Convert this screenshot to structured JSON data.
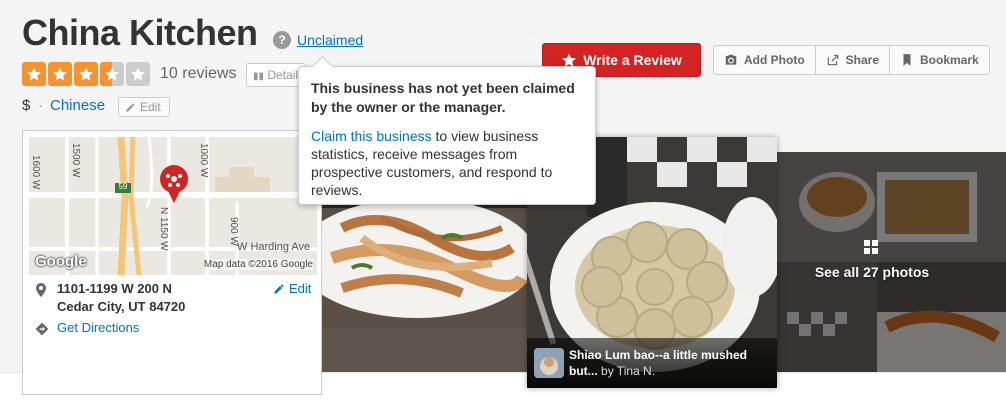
{
  "business": {
    "name": "China Kitchen",
    "claim_status": "Unclaimed",
    "help_icon": "?",
    "rating": 3.5,
    "rating_max": 5,
    "review_count": "10 reviews",
    "details_label": "Details",
    "price": "$",
    "separator": "·",
    "category": "Chinese",
    "category_edit": "Edit"
  },
  "actions": {
    "write_review": "Write a Review",
    "add_photo": "Add Photo",
    "share": "Share",
    "bookmark": "Bookmark"
  },
  "tooltip": {
    "heading": "This business has not yet been claimed by the owner or the manager.",
    "link_text": "Claim this business",
    "body_rest": " to view business statistics, receive messages from prospective customers, and respond to reviews."
  },
  "map": {
    "labels": {
      "w1600": "1600 W",
      "w1500": "1500 W",
      "w1000": "1000 W",
      "w900": "900 W",
      "n1150": "N 1150 W",
      "harding": "W Harding Ave",
      "hwy": "59"
    },
    "google": "Google",
    "credit": "Map data ©2016 Google"
  },
  "address": {
    "line1": "1101-1199 W 200 N",
    "line2": "Cedar City, UT 84720",
    "edit": "Edit",
    "directions": "Get Directions"
  },
  "photos": {
    "caption_title": "Shiao Lum bao--a little mushed but...",
    "caption_by": "by Tina N.",
    "see_all": "See all 27 photos"
  },
  "colors": {
    "brand_red": "#d32323",
    "link_blue": "#0073bb",
    "star_orange": "#f8922e",
    "star_empty": "#cccccc"
  }
}
